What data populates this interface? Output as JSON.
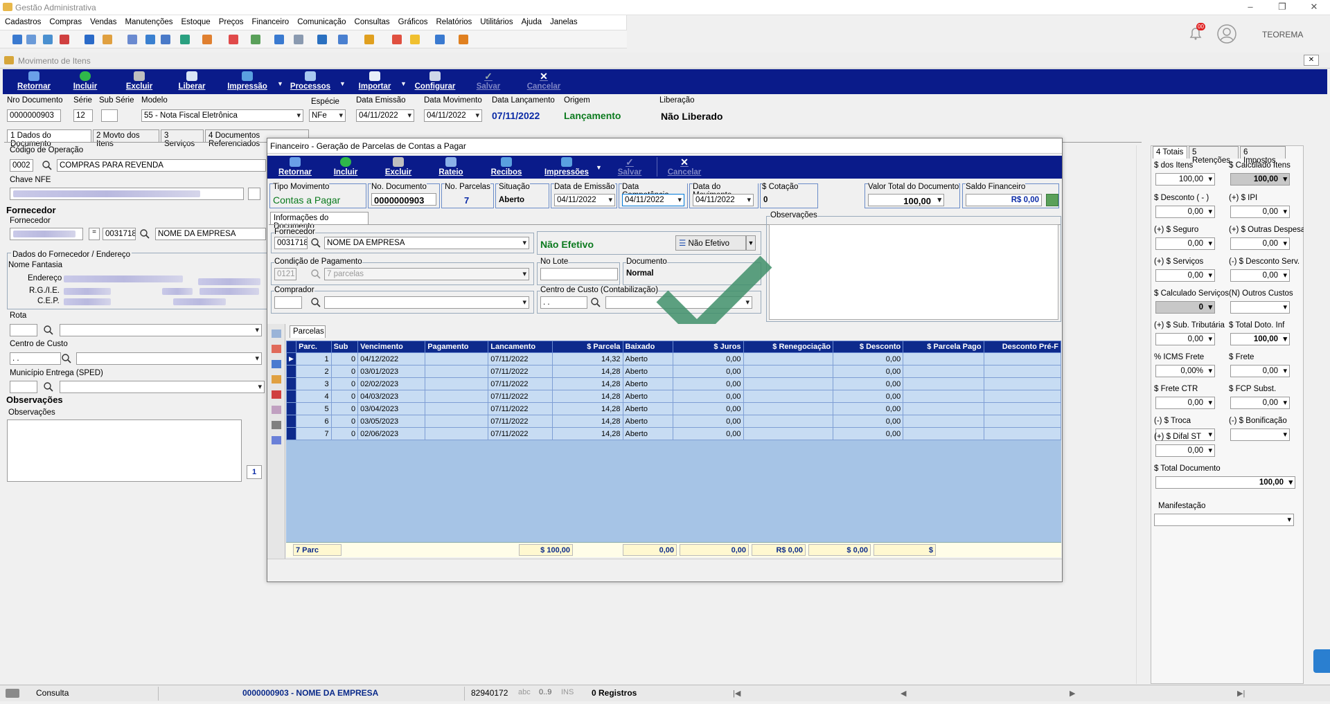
{
  "app": {
    "title": "Gestão Administrativa",
    "user": "TEOREMA",
    "notif_count": "00"
  },
  "menu": [
    "Cadastros",
    "Compras",
    "Vendas",
    "Manutenções",
    "Estoque",
    "Preços",
    "Financeiro",
    "Comunicação",
    "Consultas",
    "Gráficos",
    "Relatórios",
    "Utilitários",
    "Ajuda",
    "Janelas"
  ],
  "doc_window": {
    "title": "Movimento de Itens",
    "close": "✕"
  },
  "toolbar": {
    "retornar": "Retornar",
    "incluir": "Incluir",
    "excluir": "Excluir",
    "liberar": "Liberar",
    "impressao": "Impressão",
    "processos": "Processos",
    "importar": "Importar",
    "configurar": "Configurar",
    "salvar": "Salvar",
    "cancelar": "Cancelar"
  },
  "header": {
    "nro_doc_label": "Nro Documento",
    "nro_doc": "0000000903",
    "serie_label": "Série",
    "serie": "12",
    "subserie_label": "Sub Série",
    "subserie": "",
    "modelo_label": "Modelo",
    "modelo": "55 - Nota Fiscal Eletrônica",
    "especie_label": "Espécie",
    "especie": "NFe",
    "data_emissao_label": "Data Emissão",
    "data_emissao": "04/11/2022",
    "data_mov_label": "Data Movimento",
    "data_mov": "04/11/2022",
    "data_lanc_label": "Data Lançamento",
    "data_lanc": "07/11/2022",
    "origem_label": "Origem",
    "origem": "Lançamento",
    "liberacao_label": "Liberação",
    "liberacao": "Não Liberado"
  },
  "tabs": [
    "1 Dados do Documento",
    "2 Movto dos Itens",
    "3 Serviços",
    "4 Documentos Referenciados"
  ],
  "left": {
    "cod_op_label": "Código de Operação",
    "cod_op": "0002",
    "cod_op_desc": "COMPRAS PARA REVENDA",
    "chave_label": "Chave NFE",
    "fornecedor_title": "Fornecedor",
    "fornecedor_label": "Fornecedor",
    "forn_code": "0031718",
    "forn_name": "NOME DA EMPRESA",
    "dados_title": "Dados do Fornecedor / Endereço",
    "nome_fantasia": "Nome Fantasia",
    "endereco": "Endereço",
    "rg_ie": "R.G./I.E.",
    "cep": "C.E.P.",
    "rota_label": "Rota",
    "centro_label": "Centro de Custo",
    "centro_val": ". .",
    "municipio_label": "Município Entrega (SPED)",
    "obs_title": "Observações",
    "obs_label": "Observações",
    "obs_page": "1"
  },
  "dialog": {
    "title": "Financeiro - Geração de Parcelas de Contas a Pagar",
    "toolbar": {
      "retornar": "Retornar",
      "incluir": "Incluir",
      "excluir": "Excluir",
      "rateio": "Rateio",
      "recibos": "Recibos",
      "impressoes": "Impressões",
      "salvar": "Salvar",
      "cancelar": "Cancelar"
    },
    "tipo_mov_label": "Tipo Movimento",
    "tipo_mov": "Contas a Pagar",
    "no_doc_label": "No. Documento",
    "no_doc": "0000000903",
    "no_parc_label": "No. Parcelas",
    "no_parc": "7",
    "situacao_label": "Situação",
    "situacao": "Aberto",
    "data_emissao_label": "Data de Emissão",
    "data_emissao": "04/11/2022",
    "data_comp_label": "Data Competência",
    "data_comp": "04/11/2022",
    "data_mov_label": "Data do Movimento",
    "data_mov": "04/11/2022",
    "cotacao_label": "$ Cotação",
    "cotacao": "0",
    "valor_total_label": "Valor Total do Documento",
    "valor_total": "100,00",
    "saldo_label": "Saldo Financeiro",
    "saldo": "R$ 0,00",
    "info_tab": "Informações do Documento",
    "fornecedor_label": "Fornecedor",
    "forn_code": "0031718",
    "forn_name": "NOME DA EMPRESA",
    "efetivo": "Não Efetivo",
    "efetivo_sel": "Não Efetivo",
    "obs_label": "Observações",
    "cond_pag_label": "Condição de Pagamento",
    "cond_pag_code": "0121",
    "cond_pag": "7 parcelas",
    "no_lote_label": "No Lote",
    "documento_label": "Documento",
    "documento": "Normal",
    "comprador_label": "Comprador",
    "centro_label": "Centro de Custo (Contabilização)",
    "centro_val": ". .",
    "parcelas_tab": "Parcelas",
    "columns": [
      "Parc.",
      "Sub",
      "Vencimento",
      "Pagamento",
      "Lancamento",
      "$ Parcela",
      "Baixado",
      "$ Juros",
      "$ Renegociação",
      "$ Desconto",
      "$ Parcela Pago",
      "Desconto Pré-F"
    ],
    "rows": [
      [
        "1",
        "0",
        "04/12/2022",
        "",
        "07/11/2022",
        "14,32",
        "Aberto",
        "0,00",
        "",
        "0,00",
        "",
        ""
      ],
      [
        "2",
        "0",
        "03/01/2023",
        "",
        "07/11/2022",
        "14,28",
        "Aberto",
        "0,00",
        "",
        "0,00",
        "",
        ""
      ],
      [
        "3",
        "0",
        "02/02/2023",
        "",
        "07/11/2022",
        "14,28",
        "Aberto",
        "0,00",
        "",
        "0,00",
        "",
        ""
      ],
      [
        "4",
        "0",
        "04/03/2023",
        "",
        "07/11/2022",
        "14,28",
        "Aberto",
        "0,00",
        "",
        "0,00",
        "",
        ""
      ],
      [
        "5",
        "0",
        "03/04/2023",
        "",
        "07/11/2022",
        "14,28",
        "Aberto",
        "0,00",
        "",
        "0,00",
        "",
        ""
      ],
      [
        "6",
        "0",
        "03/05/2023",
        "",
        "07/11/2022",
        "14,28",
        "Aberto",
        "0,00",
        "",
        "0,00",
        "",
        ""
      ],
      [
        "7",
        "0",
        "02/06/2023",
        "",
        "07/11/2022",
        "14,28",
        "Aberto",
        "0,00",
        "",
        "0,00",
        "",
        ""
      ]
    ],
    "footer": {
      "parc": "7 Parc",
      "parcela": "$ 100,00",
      "juros": "0,00",
      "reneg": "0,00",
      "desconto": "R$ 0,00",
      "pago": "$ 0,00",
      "desc_pre": "$"
    }
  },
  "side": {
    "tabs": [
      "4 Totais",
      "5 Retenções",
      "6 Impostos"
    ],
    "fields": [
      {
        "label": "$ dos Itens",
        "value": "100,00"
      },
      {
        "label": "$ Calculado Itens",
        "value": "100,00"
      },
      {
        "label": "$ Desconto ( - )",
        "value": "0,00"
      },
      {
        "label": "(+) $ IPI",
        "value": "0,00"
      },
      {
        "label": "(+) $ Seguro",
        "value": "0,00"
      },
      {
        "label": "(+) $ Outras Despesas",
        "value": "0,00"
      },
      {
        "label": "(+) $ Serviços",
        "value": "0,00"
      },
      {
        "label": "(-) $ Desconto Serv.",
        "value": "0,00"
      },
      {
        "label": "$ Calculado Serviços",
        "value": "0"
      },
      {
        "label": "(N) Outros Custos",
        "value": ""
      },
      {
        "label": "(+) $ Sub. Tributária",
        "value": "0,00"
      },
      {
        "label": "$ Total Doto. Inf",
        "value": "100,00"
      },
      {
        "label": "% ICMS Frete",
        "value": "0,00%"
      },
      {
        "label": "$ Frete",
        "value": "0,00"
      },
      {
        "label": "$ Frete CTR",
        "value": "0,00"
      },
      {
        "label": "$ FCP Subst.",
        "value": "0,00"
      },
      {
        "label": "(-) $ Troca",
        "value": ""
      },
      {
        "label": "(-) $ Bonificação",
        "value": ""
      },
      {
        "label": "(+) $ Difal ST",
        "value": "0,00"
      },
      {
        "label": "$ Total Documento",
        "value": "100,00"
      },
      {
        "label": "Manifestação",
        "value": ""
      }
    ]
  },
  "status": {
    "mode": "Consulta",
    "doc": "0000000903 - NOME DA EMPRESA",
    "code": "82940172",
    "abc": "abc",
    "range": "0..9",
    "ins": "INS",
    "registros": "0 Registros"
  }
}
